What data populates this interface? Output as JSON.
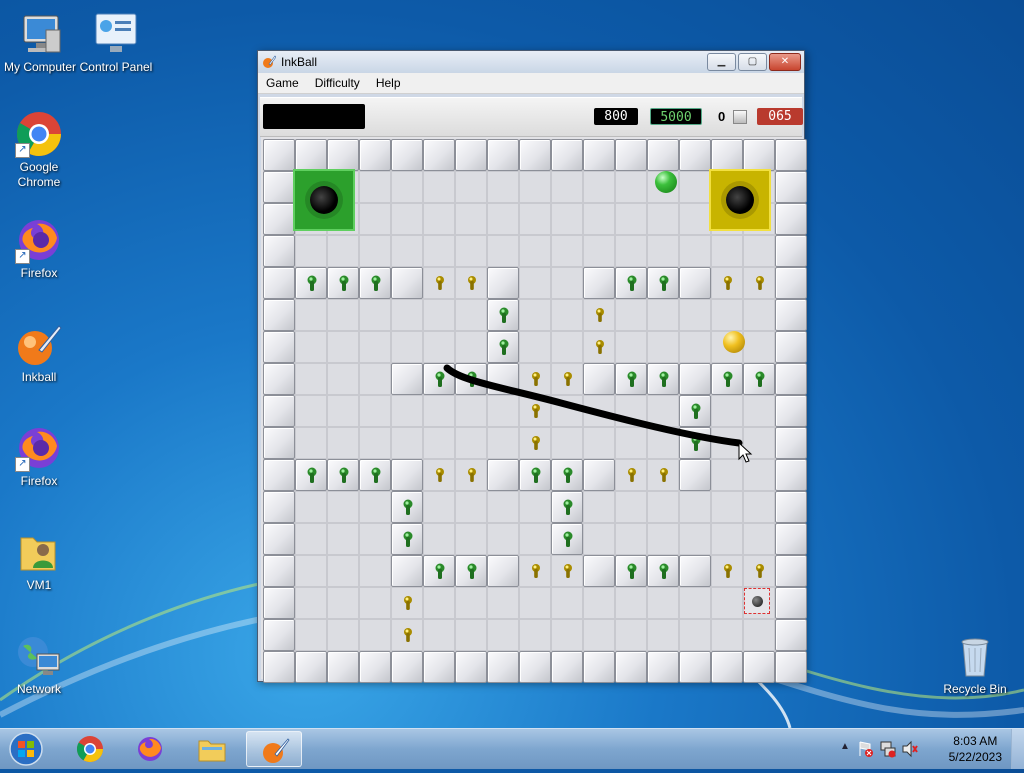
{
  "desktop": {
    "icons": [
      {
        "label": "My Computer"
      },
      {
        "label": "Control Panel"
      },
      {
        "label": "Google\nChrome"
      },
      {
        "label": "Firefox"
      },
      {
        "label": "Inkball"
      },
      {
        "label": "Firefox"
      },
      {
        "label": "VM1"
      },
      {
        "label": "Network"
      },
      {
        "label": "Recycle Bin"
      }
    ]
  },
  "window": {
    "title": "InkBall",
    "menu": [
      "Game",
      "Difficulty",
      "Help"
    ],
    "hud": {
      "score": "800",
      "target": "5000",
      "balls_count": "0",
      "timer": "065"
    }
  },
  "board": {
    "cols": 17,
    "rows": 17,
    "cell_types": "#=wall, .=floor, g=green-key block, y=yellow-key floor",
    "layout": [
      "#################",
      "#...............#",
      "#...............#",
      "#...............#",
      "#ggg#yy#..#gg#yy#",
      "#......g..y.....#",
      "#......g..y.....#",
      "#...#gg#yy#gg#gg#",
      "#.......y....g..#",
      "#.......y....g..#",
      "#ggg#yy#gg#yy#..#",
      "#...g....g......#",
      "#...g....g......#",
      "#...#gg#yy#gg#yy#",
      "#...y...........#",
      "#...y...........#",
      "#################"
    ],
    "holes": [
      {
        "color": "green",
        "hex": "#2ca02c"
      },
      {
        "color": "yellow",
        "hex": "#c8b400"
      }
    ],
    "balls": [
      {
        "color": "green"
      },
      {
        "color": "yellow"
      }
    ]
  },
  "taskbar": {
    "apps": [
      "Start",
      "Google Chrome",
      "Firefox",
      "Windows Explorer",
      "InkBall"
    ],
    "clock": {
      "time": "8:03 AM",
      "date": "5/22/2023"
    }
  }
}
